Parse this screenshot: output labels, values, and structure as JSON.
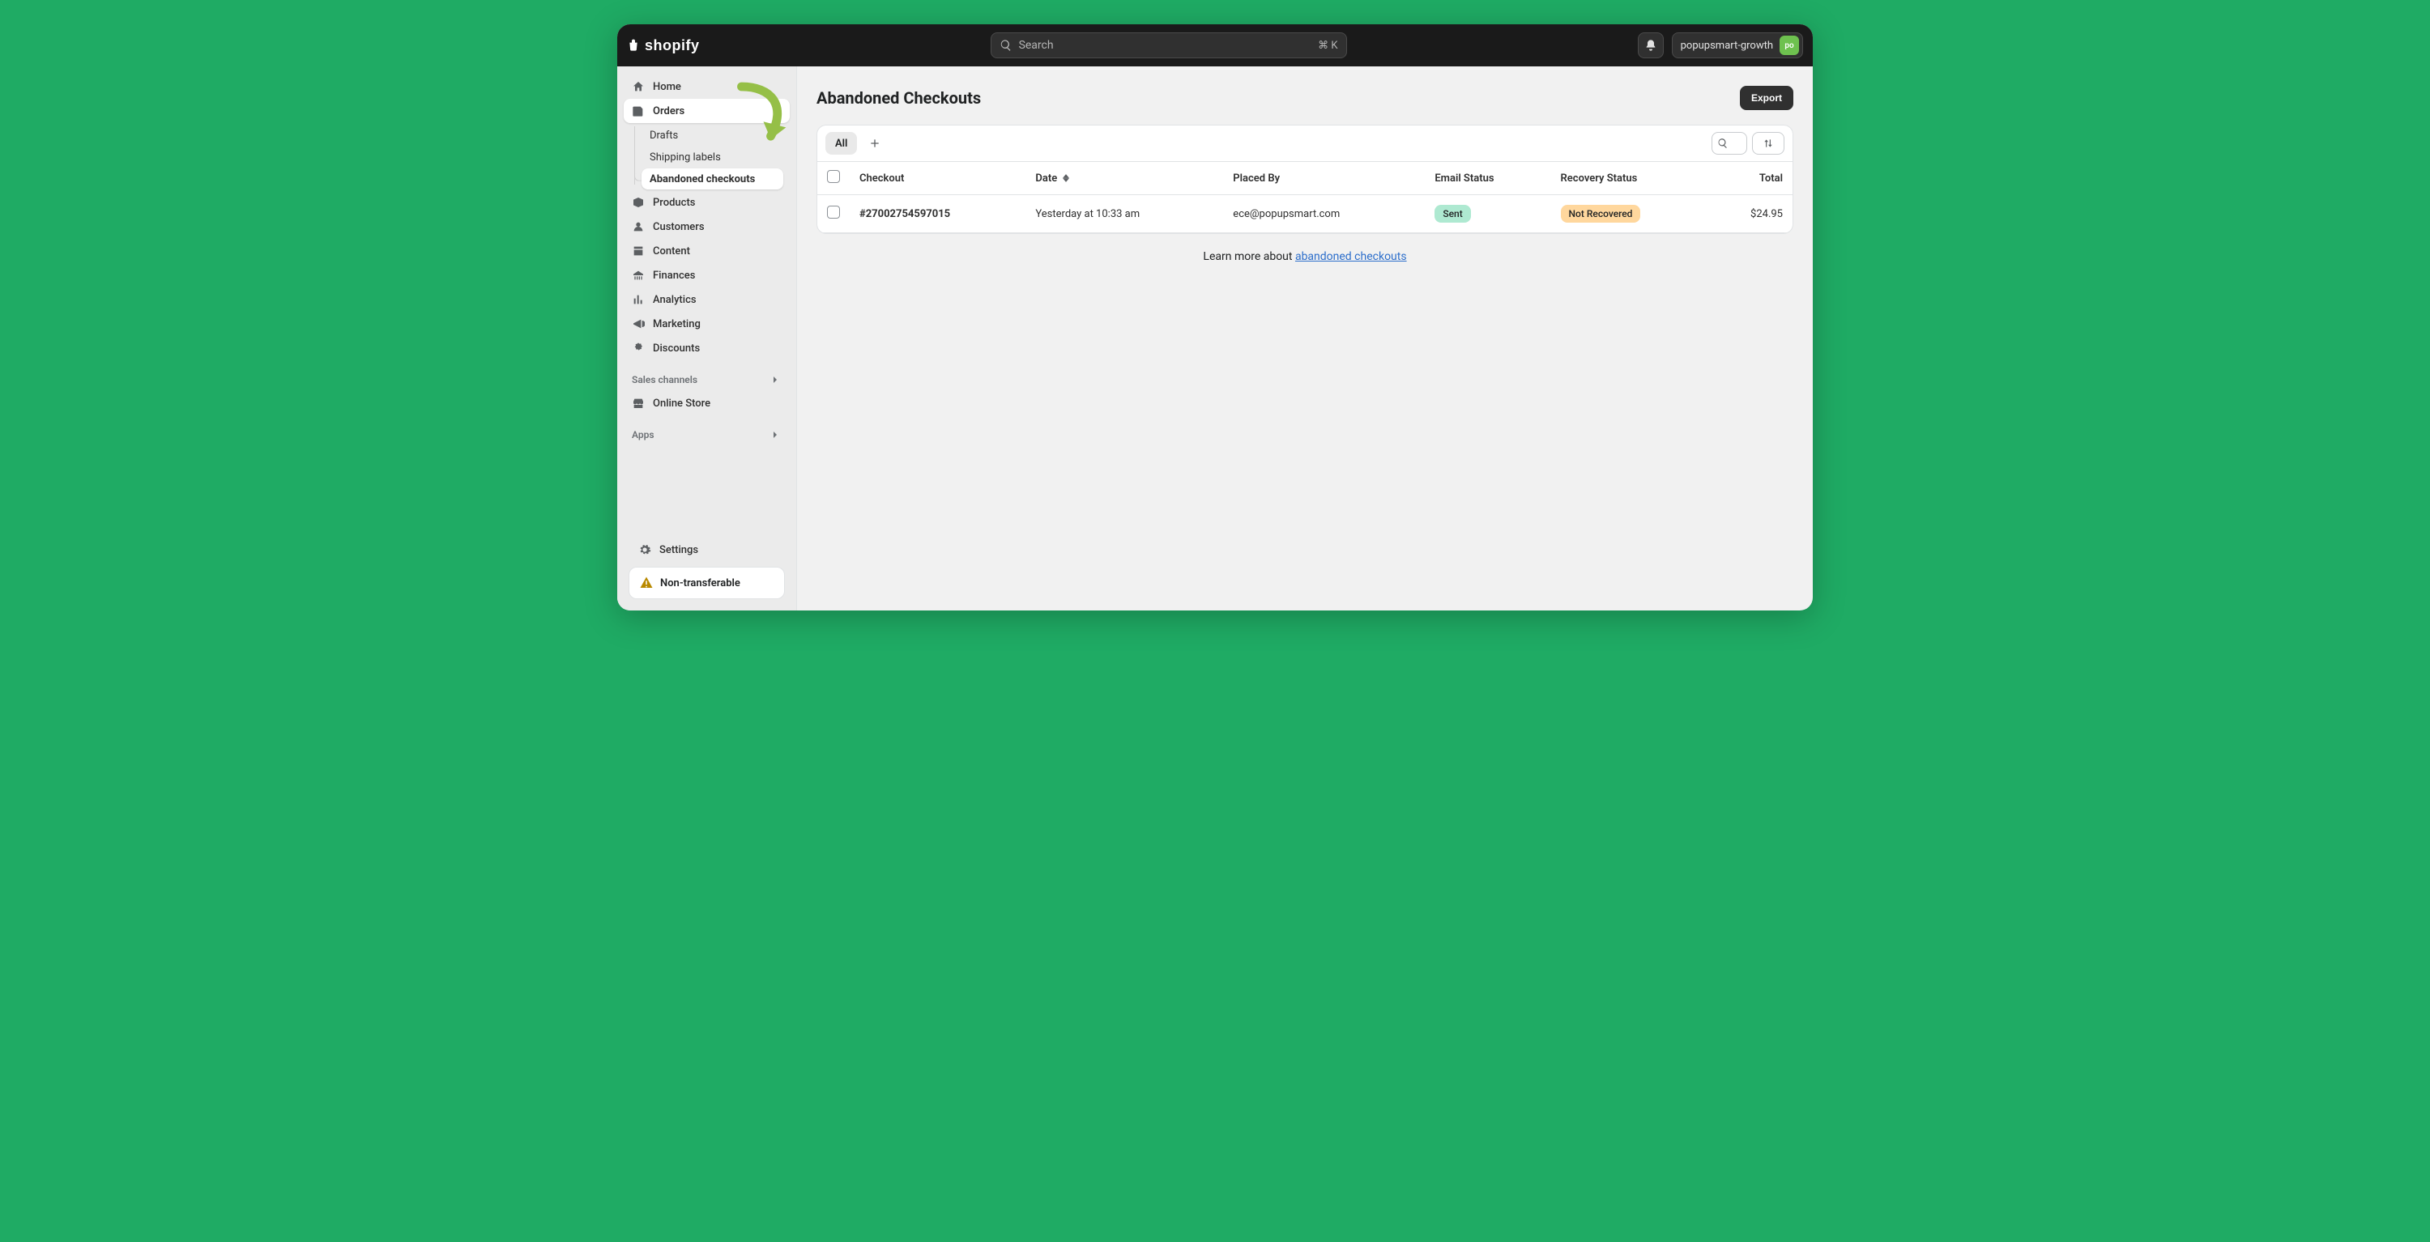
{
  "topbar": {
    "brand": "shopify",
    "search_placeholder": "Search",
    "search_kbd": "⌘ K",
    "store_name": "popupsmart-growth",
    "avatar_initials": "po"
  },
  "sidebar": {
    "items": [
      {
        "label": "Home",
        "icon": "home-icon"
      },
      {
        "label": "Orders",
        "icon": "orders-icon",
        "active": true
      },
      {
        "label": "Products",
        "icon": "products-icon"
      },
      {
        "label": "Customers",
        "icon": "customers-icon"
      },
      {
        "label": "Content",
        "icon": "content-icon"
      },
      {
        "label": "Finances",
        "icon": "finances-icon"
      },
      {
        "label": "Analytics",
        "icon": "analytics-icon"
      },
      {
        "label": "Marketing",
        "icon": "marketing-icon"
      },
      {
        "label": "Discounts",
        "icon": "discounts-icon"
      }
    ],
    "orders_sub": [
      {
        "label": "Drafts"
      },
      {
        "label": "Shipping labels"
      },
      {
        "label": "Abandoned checkouts",
        "active": true
      }
    ],
    "sections": [
      {
        "title": "Sales channels",
        "items": [
          {
            "label": "Online Store",
            "icon": "store-icon"
          }
        ]
      },
      {
        "title": "Apps",
        "items": []
      }
    ],
    "settings_label": "Settings",
    "footer_warning": "Non-transferable"
  },
  "page": {
    "title": "Abandoned Checkouts",
    "export_label": "Export"
  },
  "toolbar": {
    "tab_all": "All"
  },
  "table": {
    "columns": {
      "checkout": "Checkout",
      "date": "Date",
      "placed_by": "Placed By",
      "email_status": "Email Status",
      "recovery_status": "Recovery Status",
      "total": "Total"
    },
    "rows": [
      {
        "checkout": "#27002754597015",
        "date": "Yesterday at 10:33 am",
        "placed_by": "ece@popupsmart.com",
        "email_status": "Sent",
        "recovery_status": "Not Recovered",
        "total": "$24.95"
      }
    ]
  },
  "footer_note": {
    "prefix": "Learn more about ",
    "link_text": "abandoned checkouts"
  }
}
